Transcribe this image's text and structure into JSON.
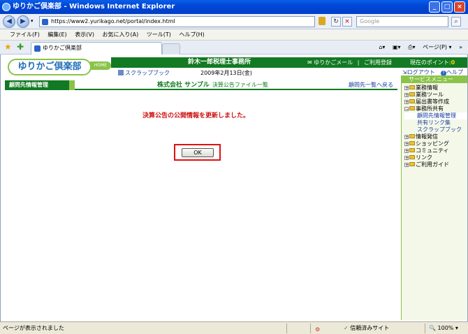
{
  "window": {
    "title": "ゆりかご倶楽部 - Windows Internet Explorer",
    "minimize": "_",
    "maximize": "□",
    "close": "×"
  },
  "address": {
    "url": "https://www2.yurikago.net/portal/index.html",
    "search_placeholder": "Google"
  },
  "menu": [
    "ファイル(F)",
    "編集(E)",
    "表示(V)",
    "お気に入り(A)",
    "ツール(T)",
    "ヘルプ(H)"
  ],
  "tab": {
    "label": "ゆりかご倶楽部"
  },
  "toolbar": {
    "page_label": "ページ(P) ▾"
  },
  "site": {
    "logo": "ゆりかご倶楽部",
    "home_tag": "HOME",
    "office_name": "鈴木一郎税理士事務所",
    "mail_link": "ゆりかごメール",
    "signup_link": "ご利用登録",
    "points_label": "現在のポイント:",
    "points_value": "0",
    "scrapbook": "スクラップブック",
    "date": "2009年2月13日(金)",
    "logout": "ログアウト",
    "help": "ヘルプ"
  },
  "client": {
    "section_label": "顧問先情報管理",
    "company": "株式会社 サンプル",
    "sub_page": "決算公告ファイル一覧",
    "back_link": "顧問先一覧へ戻る"
  },
  "main": {
    "message": "決算公告の公開情報を更新しました。",
    "ok_label": "OK"
  },
  "sidemenu": {
    "header": "サービスメニュー",
    "items": [
      {
        "label": "業務情報",
        "expander": "+"
      },
      {
        "label": "業務ツール",
        "expander": "+"
      },
      {
        "label": "届出書等作成",
        "expander": "+"
      },
      {
        "label": "事務所共有",
        "expander": "−"
      }
    ],
    "subitems": [
      "顧問先情報管理",
      "共有リンク集",
      "スクラップブック"
    ],
    "items_after": [
      {
        "label": "情報発信",
        "expander": "+"
      },
      {
        "label": "ショッピング",
        "expander": "+"
      },
      {
        "label": "コミュニティ",
        "expander": "+"
      },
      {
        "label": "リンク",
        "expander": "+"
      },
      {
        "label": "ご利用ガイド",
        "expander": "+"
      }
    ]
  },
  "status": {
    "text": "ページが表示されました",
    "trust": "信頼済みサイト",
    "zoom": "100%"
  }
}
